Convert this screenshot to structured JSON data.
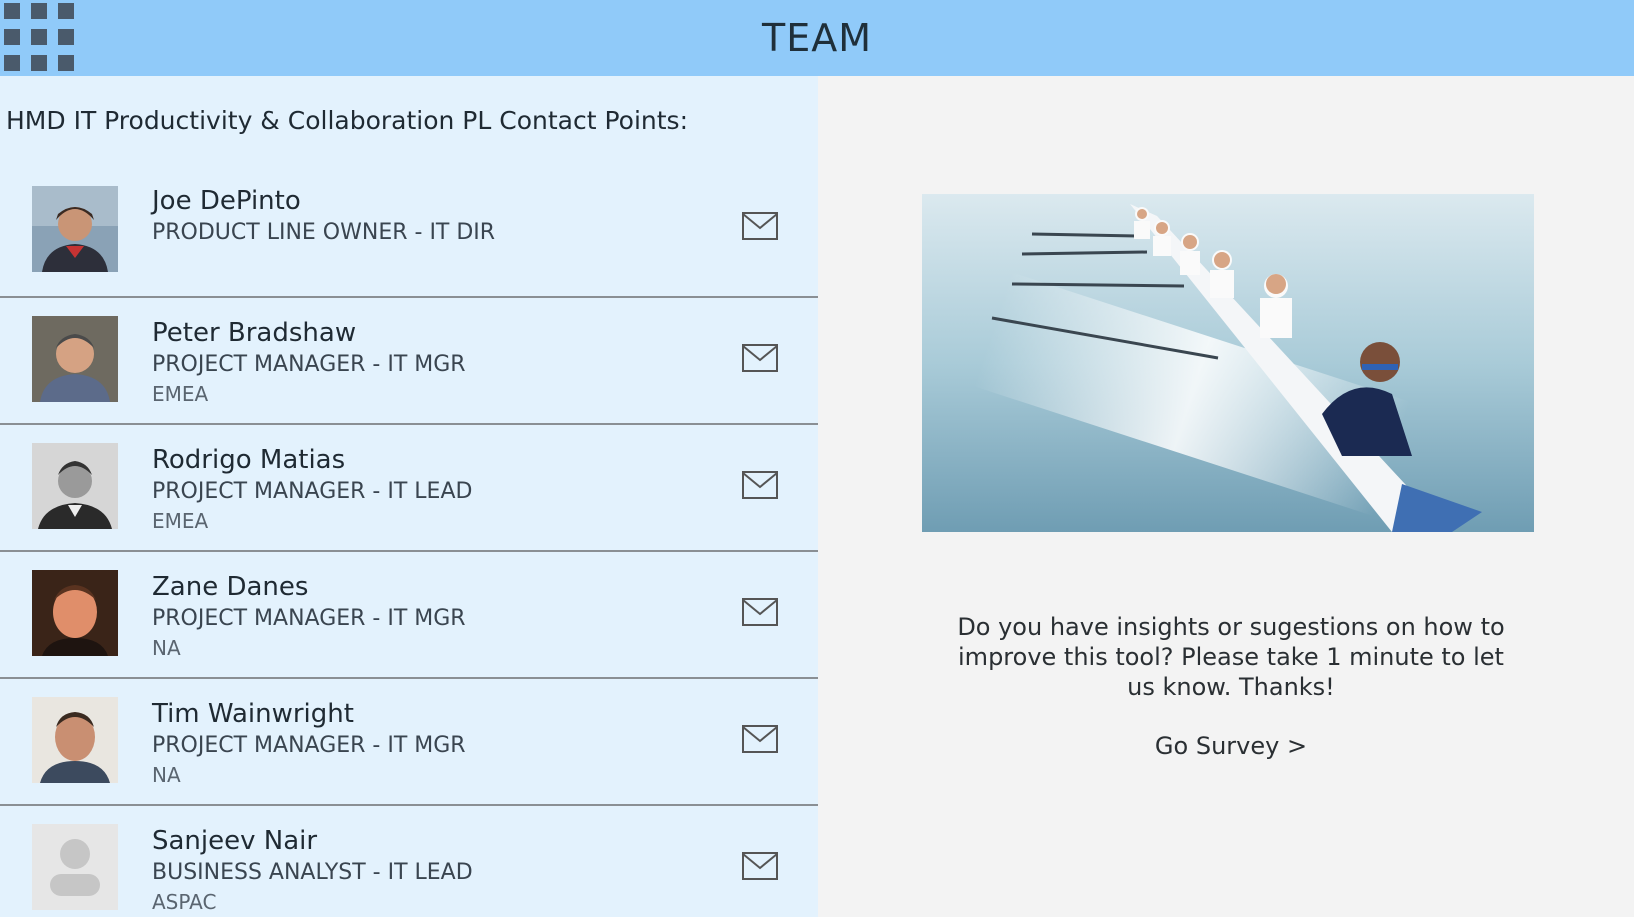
{
  "header": {
    "title": "TEAM",
    "app_grid_icon": "app-launcher-grid-icon"
  },
  "contacts_section": {
    "title": "HMD IT Productivity & Collaboration PL Contact Points:",
    "contacts": [
      {
        "name": "Joe DePinto",
        "role": "PRODUCT LINE OWNER - IT DIR",
        "region": "",
        "avatar": "photo"
      },
      {
        "name": "Peter Bradshaw",
        "role": "PROJECT MANAGER - IT MGR",
        "region": "EMEA",
        "avatar": "photo"
      },
      {
        "name": "Rodrigo Matias",
        "role": "PROJECT MANAGER - IT LEAD",
        "region": "EMEA",
        "avatar": "photo"
      },
      {
        "name": "Zane Danes",
        "role": "PROJECT MANAGER - IT MGR",
        "region": "NA",
        "avatar": "photo"
      },
      {
        "name": "Tim Wainwright",
        "role": "PROJECT MANAGER - IT MGR",
        "region": "NA",
        "avatar": "photo"
      },
      {
        "name": "Sanjeev Nair",
        "role": "BUSINESS ANALYST - IT LEAD",
        "region": "ASPAC",
        "avatar": "placeholder"
      }
    ],
    "mail_icon": "mail-icon"
  },
  "survey": {
    "text": "Do you have insights or sugestions on how to improve this tool? Please take 1 minute to let us know. Thanks!",
    "link_label": "Go Survey >"
  },
  "colors": {
    "header_bg": "#90caf9",
    "left_panel_bg": "#e3f2fd",
    "right_panel_bg": "#f3f3f3"
  }
}
